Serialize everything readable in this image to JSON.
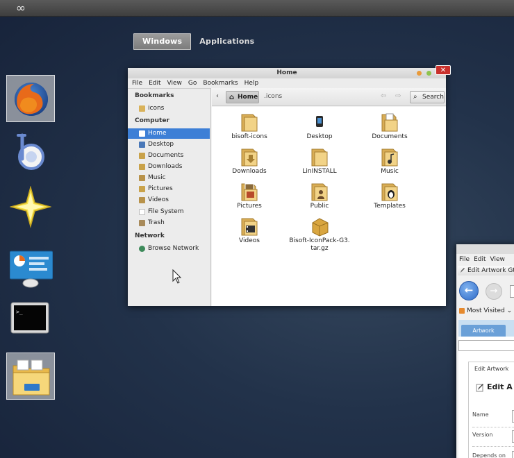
{
  "top_panel": {
    "logo_icon": "infinity-icon"
  },
  "switcher": {
    "windows_label": "Windows",
    "applications_label": "Applications"
  },
  "dock": {
    "items": [
      {
        "name": "firefox",
        "icon": "firefox-icon",
        "active": true
      },
      {
        "name": "banshee",
        "icon": "banshee-icon"
      },
      {
        "name": "favorites-star",
        "icon": "star-icon"
      },
      {
        "name": "system-monitor",
        "icon": "system-monitor-icon"
      },
      {
        "name": "terminal",
        "icon": "terminal-icon"
      },
      {
        "name": "files",
        "icon": "file-manager-icon"
      }
    ]
  },
  "file_manager": {
    "title": "Home",
    "menu": [
      "File",
      "Edit",
      "View",
      "Go",
      "Bookmarks",
      "Help"
    ],
    "sidebar": {
      "bookmarks_heading": "Bookmarks",
      "bookmarks": [
        "icons"
      ],
      "computer_heading": "Computer",
      "computer": [
        "Home",
        "Desktop",
        "Documents",
        "Downloads",
        "Music",
        "Pictures",
        "Videos",
        "File System",
        "Trash"
      ],
      "network_heading": "Network",
      "network": [
        "Browse Network"
      ]
    },
    "path": {
      "back_glyph": "‹",
      "current": "Home",
      "next": ".icons"
    },
    "search_label": "Search",
    "files": [
      {
        "label": "bisoft-icons",
        "icon": "folder-icon"
      },
      {
        "label": "Desktop",
        "icon": "phone-icon"
      },
      {
        "label": "Documents",
        "icon": "folder-documents-icon"
      },
      {
        "label": "Downloads",
        "icon": "folder-downloads-icon"
      },
      {
        "label": "LinINSTALL",
        "icon": "folder-icon"
      },
      {
        "label": "Music",
        "icon": "folder-music-icon"
      },
      {
        "label": "Pictures",
        "icon": "folder-pictures-icon"
      },
      {
        "label": "Public",
        "icon": "folder-public-icon"
      },
      {
        "label": "Templates",
        "icon": "folder-templates-icon"
      },
      {
        "label": "Videos",
        "icon": "folder-videos-icon"
      },
      {
        "label": "Bisoft-IconPack-G3.tar.gz",
        "icon": "archive-icon"
      }
    ]
  },
  "browser": {
    "menu": [
      "File",
      "Edit",
      "View"
    ],
    "tab_label": "Edit Artwork Gt",
    "back_glyph": "←",
    "forward_glyph": "→",
    "most_visited": "Most Visited",
    "page": {
      "artwork_tab": "Artwork",
      "panel_head": "Edit  Artwork",
      "panel_title": "Edit A",
      "field_labels": [
        "Name",
        "Version",
        "Depends on"
      ]
    }
  },
  "colors": {
    "selection": "#3d7fd6",
    "close": "#c9302c",
    "desktop": "#22324a"
  }
}
